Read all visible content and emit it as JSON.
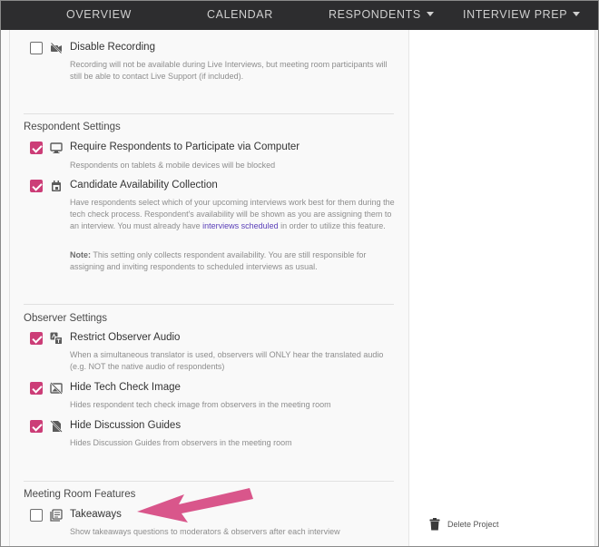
{
  "nav": {
    "overview": "OVERVIEW",
    "calendar": "CALENDAR",
    "respondents": "RESPONDENTS",
    "interview_prep": "INTERVIEW PREP"
  },
  "options": {
    "disable_recording": {
      "label": "Disable Recording",
      "checked": false,
      "icon": "video-off-icon",
      "desc": "Recording will not be available during Live Interviews, but meeting room participants will still be able to contact Live Support (if included)."
    },
    "require_computer": {
      "label": "Require Respondents to Participate via Computer",
      "checked": true,
      "icon": "monitor-icon",
      "desc": "Respondents on tablets & mobile devices will be blocked"
    },
    "availability": {
      "label": "Candidate Availability Collection",
      "checked": true,
      "icon": "calendar-icon",
      "desc_before": "Have respondents select which of your upcoming interviews work best for them during the tech check process. Respondent's availability will be shown as you are assigning them to an interview. You must already have ",
      "desc_link": "interviews scheduled",
      "desc_after": " in order to utilize this feature.",
      "note_label": "Note:",
      "note_text": " This setting only collects respondent availability. You are still responsible for assigning and inviting respondents to scheduled interviews as usual."
    },
    "restrict_audio": {
      "label": "Restrict Observer Audio",
      "checked": true,
      "icon": "translate-icon",
      "desc": "When a simultaneous translator is used, observers will ONLY hear the translated audio (e.g. NOT the native audio of respondents)"
    },
    "hide_tech_check": {
      "label": "Hide Tech Check Image",
      "checked": true,
      "icon": "image-off-icon",
      "desc": "Hides respondent tech check image from observers in the meeting room"
    },
    "hide_guides": {
      "label": "Hide Discussion Guides",
      "checked": true,
      "icon": "document-off-icon",
      "desc": "Hides Discussion Guides from observers in the meeting room"
    },
    "takeaways": {
      "label": "Takeaways",
      "checked": false,
      "icon": "notes-icon",
      "desc": "Show takeaways questions to moderators & observers after each interview"
    }
  },
  "sections": {
    "respondent": "Respondent Settings",
    "observer": "Observer Settings",
    "meeting_room": "Meeting Room Features"
  },
  "sidebar": {
    "delete_label": "Delete Project"
  },
  "colors": {
    "accent": "#cc3d77",
    "nav_bg": "#2d2d2f",
    "arrow": "#d9568b",
    "link": "#5a3fb8"
  }
}
